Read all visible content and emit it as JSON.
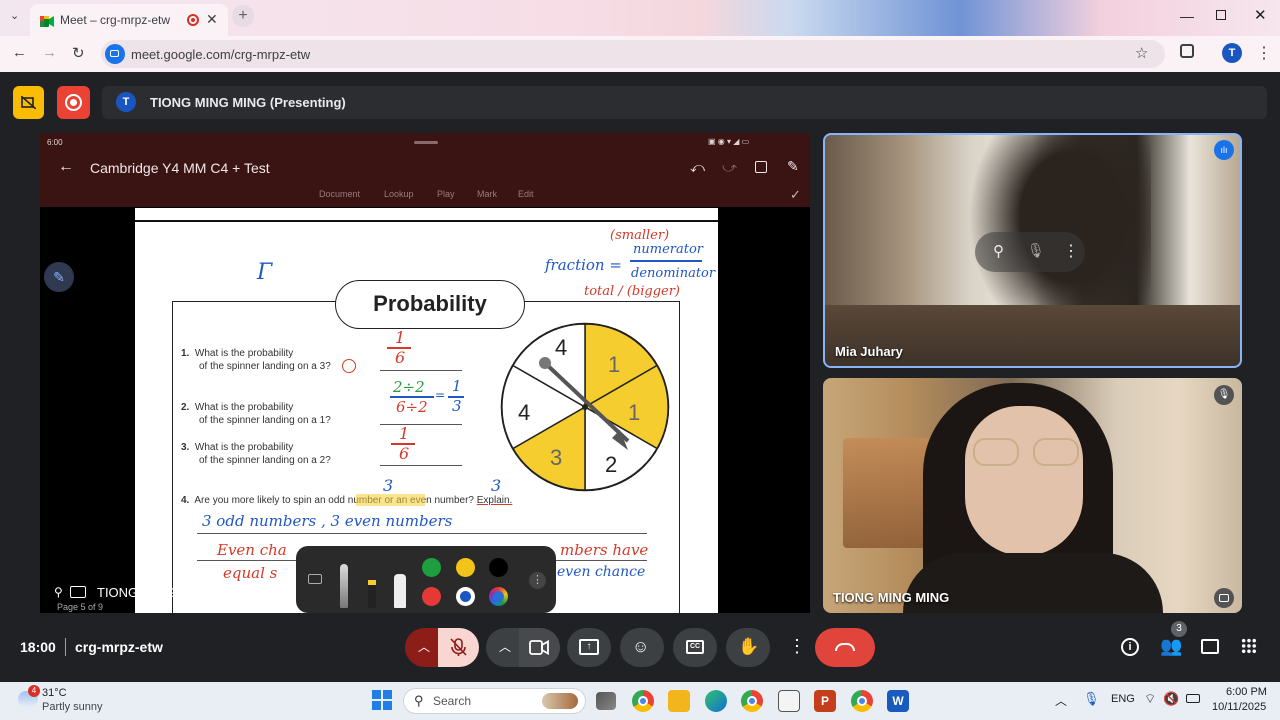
{
  "browser": {
    "tab_title": "Meet – crg-mrpz-etw",
    "url": "meet.google.com/crg-mrpz-etw",
    "profile_initial": "T"
  },
  "meet": {
    "presenter_initial": "T",
    "presenter_label": "TIONG MING MING (Presenting)",
    "time": "18:00",
    "meeting_code": "crg-mrpz-etw",
    "participant_count": "3"
  },
  "presentation": {
    "status_time": "6:00",
    "doc_title": "Cambridge Y4 MM C4 + Test",
    "tabs": [
      "Document",
      "Lookup",
      "Play",
      "Mark",
      "Edit"
    ],
    "page_label": "Page 5 of 9",
    "presenter_overlay": "TIONG MING MING",
    "worksheet": {
      "heading": "Probability",
      "notes": {
        "fraction": "fraction =",
        "smaller": "(smaller)",
        "numerator": "numerator",
        "denominator": "denominator",
        "total": "total / (bigger)"
      },
      "questions": [
        {
          "num": "1.",
          "line1": "What is the probability",
          "line2": "of the spinner landing on a 3?"
        },
        {
          "num": "2.",
          "line1": "What is the probability",
          "line2": "of the spinner landing on a 1?"
        },
        {
          "num": "3.",
          "line1": "What is the probability",
          "line2": "of the spinner landing on a 2?"
        }
      ],
      "q4": {
        "num": "4.",
        "text": "Are you more likely to spin an odd number or an even number?",
        "explain": "Explain."
      },
      "answers": {
        "a1_num": "1",
        "a1_den": "6",
        "a2_num": "2÷2",
        "a2_den": "6÷2",
        "a2_eq": "=",
        "a2_res_num": "1",
        "a2_res_den": "3",
        "a3_num": "1",
        "a3_den": "6",
        "q4_odd_count": "3",
        "q4_even_count": "3",
        "line1": "3 odd numbers , 3 even numbers",
        "line2a": "Even cha",
        "line2b": "mbers have",
        "line3a": "equal s",
        "line3b": "even chance"
      },
      "spinner_labels": [
        "4",
        "1",
        "1",
        "2",
        "3",
        "4"
      ]
    }
  },
  "participants": [
    {
      "name": "Mia Juhary"
    },
    {
      "name": "TIONG MING MING"
    }
  ],
  "taskbar": {
    "weather_temp": "31°C",
    "weather_desc": "Partly sunny",
    "weather_badge": "4",
    "search_placeholder": "Search",
    "lang": "ENG",
    "clock_time": "6:00 PM",
    "clock_date": "10/11/2025"
  },
  "colors": {
    "end_call": "#e0443a",
    "mic_off": "#f9d6d2",
    "accent_blue": "#1a73e8",
    "spinner_yellow": "#f5cd2f"
  }
}
